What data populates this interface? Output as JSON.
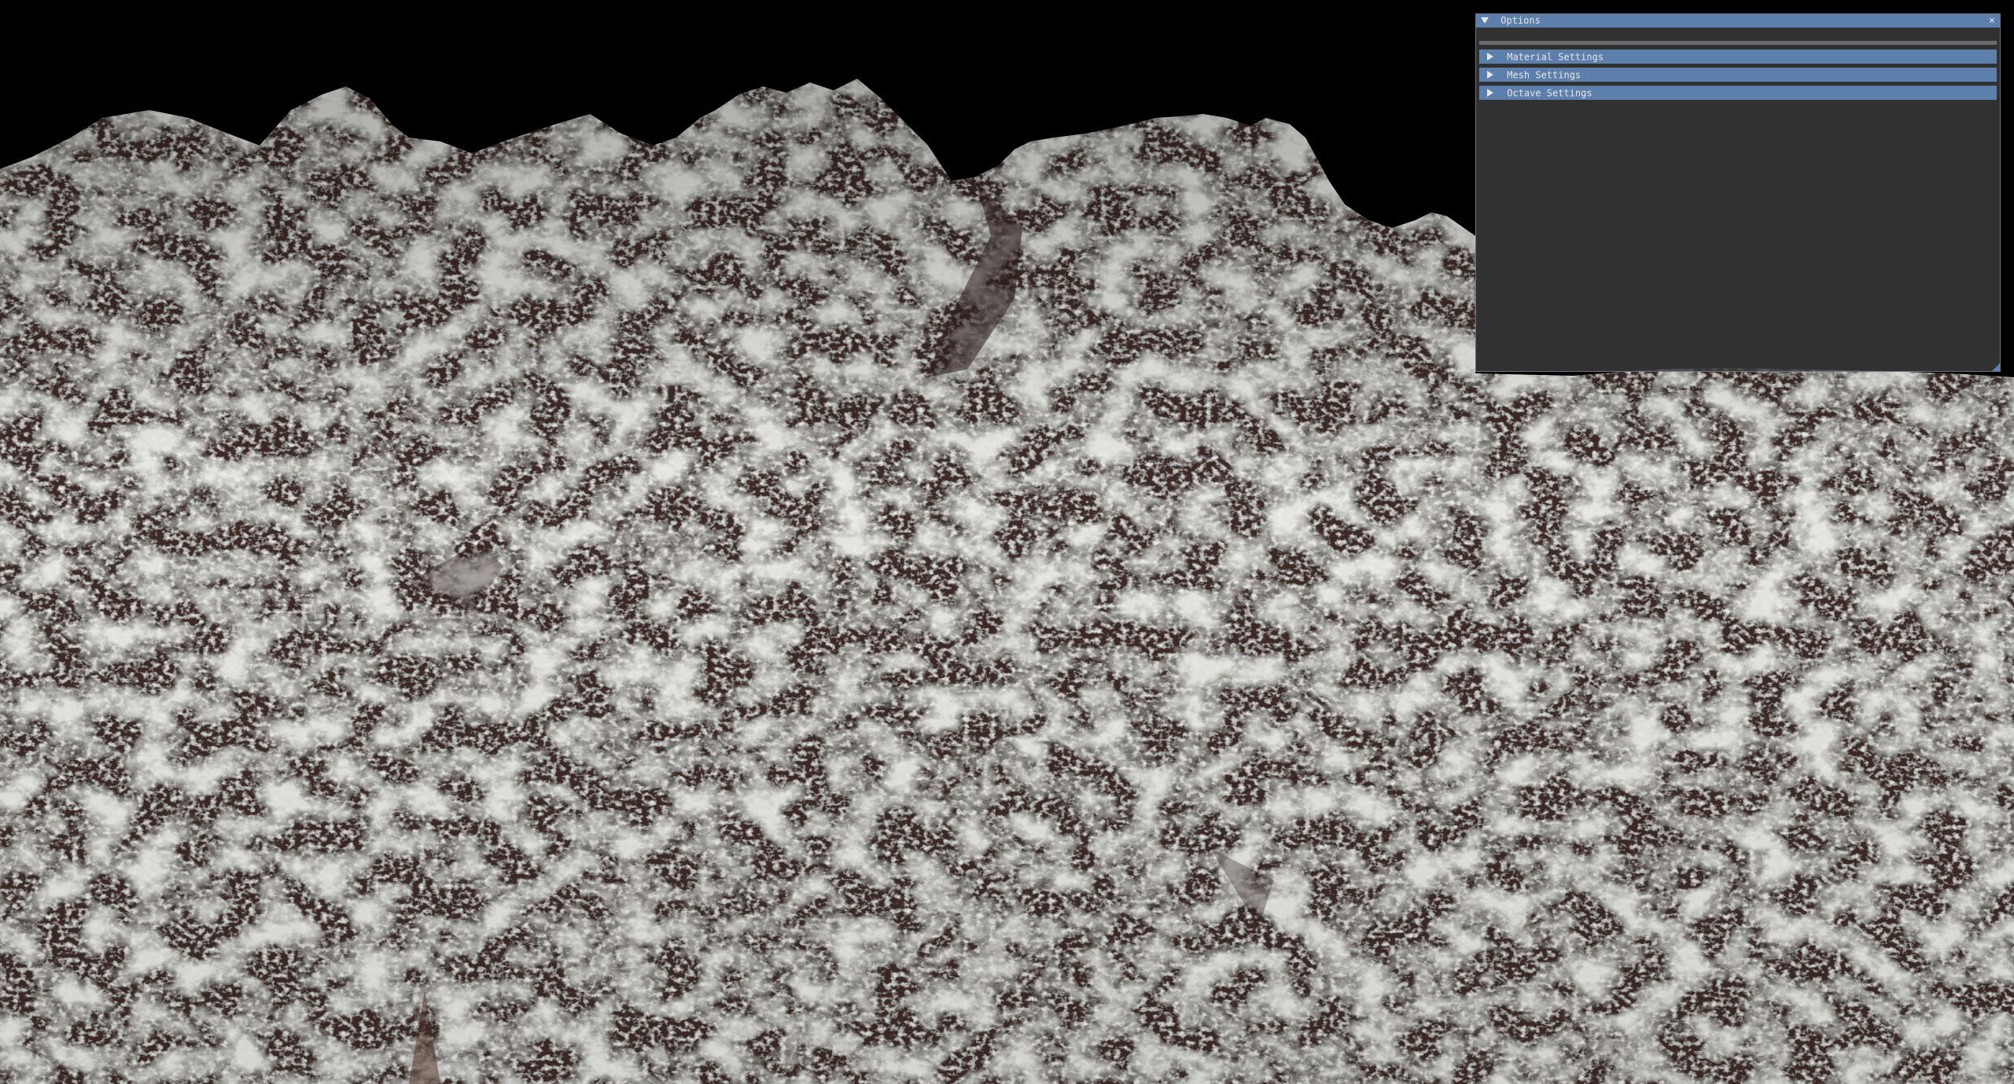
{
  "window": {
    "title": "Options",
    "close_glyph": "×",
    "sections": [
      {
        "label": "Material Settings"
      },
      {
        "label": "Mesh Settings"
      },
      {
        "label": "Octave Settings"
      }
    ]
  },
  "colors": {
    "sky": "#000000",
    "rock_light": "#c9cbc2",
    "rock_dark": "#3a2a26",
    "imgui_header": "#5d7fab",
    "imgui_window_bg": "#3c3c3c"
  },
  "icons": {
    "collapse": "triangle-down-icon",
    "expand": "triangle-right-icon",
    "close": "close-icon",
    "resize": "resize-grip-icon"
  }
}
